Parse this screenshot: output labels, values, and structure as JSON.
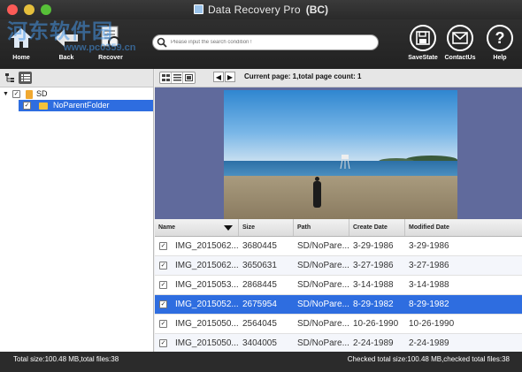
{
  "window": {
    "title": "Data Recovery Pro",
    "title_suffix": "(BC)"
  },
  "watermark": {
    "text": "河东软件园",
    "url_text": "www.pc0359.cn"
  },
  "toolbar": {
    "home_label": "Home",
    "back_label": "Back",
    "recover_label": "Recover",
    "search_placeholder": "Please input the search condition !",
    "savestate_label": "SaveState",
    "contactus_label": "ContactUs",
    "help_label": "Help"
  },
  "tree": {
    "root_label": "SD",
    "child_label": "NoParentFolder"
  },
  "pagination": {
    "info": "Current page: 1,total page count: 1"
  },
  "table": {
    "headers": [
      "Name",
      "Size",
      "Path",
      "Create Date",
      "Modified Date"
    ],
    "rows": [
      {
        "name": "IMG_2015062...",
        "size": "3680445",
        "path": "SD/NoPare...",
        "create": "3-29-1986",
        "modified": "3-29-1986"
      },
      {
        "name": "IMG_2015062...",
        "size": "3650631",
        "path": "SD/NoPare...",
        "create": "3-27-1986",
        "modified": "3-27-1986"
      },
      {
        "name": "IMG_2015053...",
        "size": "2868445",
        "path": "SD/NoPare...",
        "create": "3-14-1988",
        "modified": "3-14-1988"
      },
      {
        "name": "IMG_2015052...",
        "size": "2675954",
        "path": "SD/NoPare...",
        "create": "8-29-1982",
        "modified": "8-29-1982"
      },
      {
        "name": "IMG_2015050...",
        "size": "2564045",
        "path": "SD/NoPare...",
        "create": "10-26-1990",
        "modified": "10-26-1990"
      },
      {
        "name": "IMG_2015050...",
        "size": "3404005",
        "path": "SD/NoPare...",
        "create": "2-24-1989",
        "modified": "2-24-1989"
      }
    ]
  },
  "status": {
    "left": "Total size:100.48 MB,total files:38",
    "right": "Checked total size:100.48 MB,checked total files:38"
  },
  "colors": {
    "selection": "#2e6de0",
    "toolbar_bg": "#262626",
    "preview_bg": "#606a9c"
  }
}
